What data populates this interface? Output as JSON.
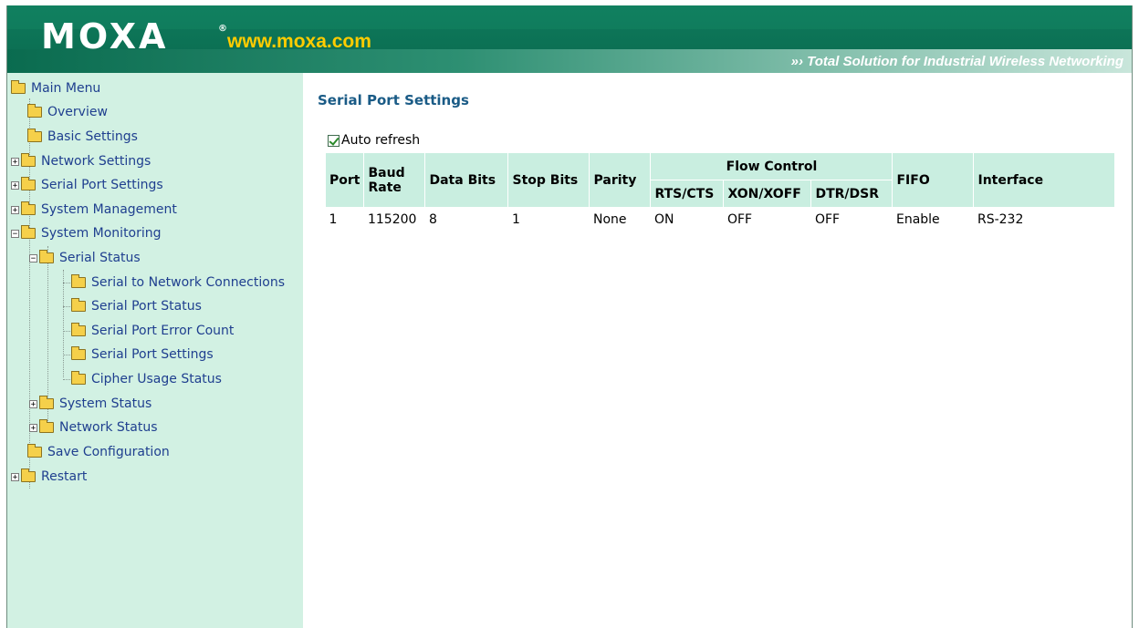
{
  "header": {
    "logo": "MOXA",
    "registered": "®",
    "url": "www.moxa.com",
    "tagline": "»› Total Solution for Industrial Wireless Networking"
  },
  "menu": {
    "items": [
      {
        "label": "Main Menu"
      },
      {
        "label": "Overview"
      },
      {
        "label": "Basic Settings"
      },
      {
        "label": "Network Settings"
      },
      {
        "label": "Serial Port Settings"
      },
      {
        "label": "System Management"
      },
      {
        "label": "System Monitoring"
      },
      {
        "label": "Serial Status"
      },
      {
        "label": "Serial to Network Connections"
      },
      {
        "label": "Serial Port Status"
      },
      {
        "label": "Serial Port Error Count"
      },
      {
        "label": "Serial Port Settings"
      },
      {
        "label": "Cipher Usage Status"
      },
      {
        "label": "System Status"
      },
      {
        "label": "Network Status"
      },
      {
        "label": "Save Configuration"
      },
      {
        "label": "Restart"
      }
    ]
  },
  "page": {
    "title": "Serial Port Settings",
    "auto_refresh_label": "Auto refresh",
    "auto_refresh_checked": true
  },
  "table": {
    "headers": {
      "port": "Port",
      "baud": "Baud Rate",
      "data_bits": "Data Bits",
      "stop_bits": "Stop Bits",
      "parity": "Parity",
      "flow_control": "Flow Control",
      "rts_cts": "RTS/CTS",
      "xon_xoff": "XON/XOFF",
      "dtr_dsr": "DTR/DSR",
      "fifo": "FIFO",
      "interface": "Interface"
    },
    "rows": [
      {
        "port": "1",
        "baud": "115200",
        "data_bits": "8",
        "stop_bits": "1",
        "parity": "None",
        "rts_cts": "ON",
        "xon_xoff": "OFF",
        "dtr_dsr": "OFF",
        "fifo": "Enable",
        "interface": "RS-232"
      }
    ]
  },
  "colors": {
    "header_green": "#0a6b4f",
    "url_yellow": "#ffcc00",
    "sidebar_bg": "#d2f1e3",
    "table_header_bg": "#c9eee0",
    "title_blue": "#1a5b86"
  }
}
